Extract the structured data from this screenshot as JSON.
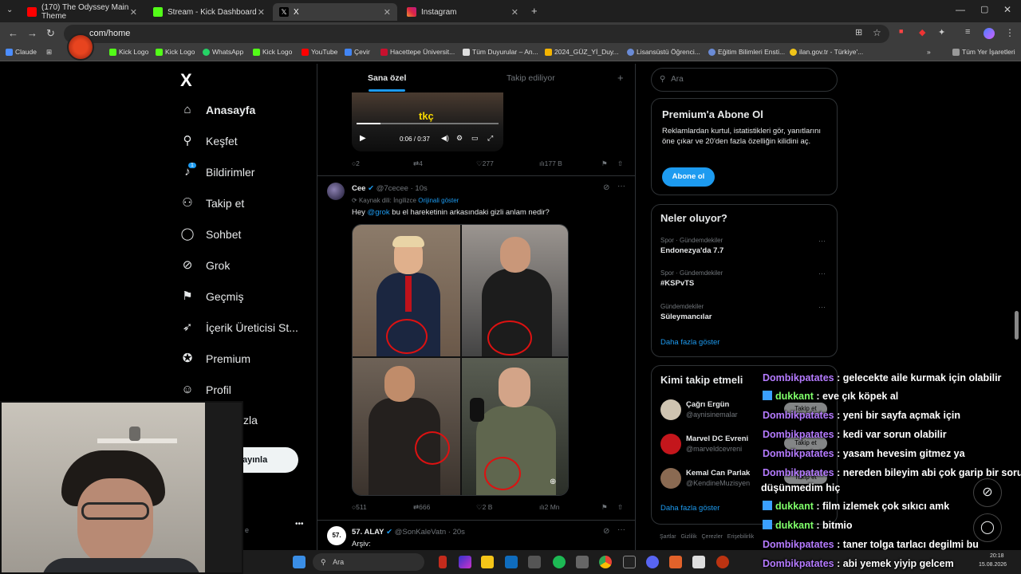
{
  "browser": {
    "tabs": [
      {
        "title": "(170) The Odyssey Main Theme",
        "color": "#ff0000"
      },
      {
        "title": "Stream - Kick Dashboard",
        "color": "#53fc18"
      },
      {
        "title": "X",
        "color": "#ffffff"
      },
      {
        "title": "Instagram",
        "color": "#e1306c"
      }
    ],
    "url": "com/home",
    "bookmarks": [
      "Claude",
      "il",
      "Kick Logo",
      "Kick Logo",
      "WhatsApp",
      "Kick Logo",
      "YouTube",
      "Çevir",
      "Hacettepe Üniversit...",
      "Tüm Duyurular – An...",
      "2024_GÜZ_Yİ_Duy...",
      "Lisansüstü Öğrenci...",
      "Eğitim Bilimleri Ensti...",
      "ilan.gov.tr - Türkiye'..."
    ],
    "all_bookmarks": "Tüm Yer İşaretleri"
  },
  "nav": {
    "logo": "X",
    "items": [
      "Anasayfa",
      "Keşfet",
      "Bildirimler",
      "Takip et",
      "Sohbet",
      "Grok",
      "Geçmiş",
      "İçerik Üreticisi St...",
      "Premium",
      "Profil",
      "zla"
    ],
    "notification_badge": "1",
    "post_button": "ayınla",
    "more": "•••",
    "bottom_text": "e"
  },
  "feed": {
    "tabs": [
      "Sana özel",
      "Takip ediliyor"
    ],
    "plus": "+",
    "video": {
      "overlay_text": "tkç",
      "time": "0:06 / 0:37"
    },
    "post1_actions": {
      "replies": "2",
      "reposts": "4",
      "likes": "277",
      "views": "177 B"
    },
    "post2": {
      "name": "Cee",
      "handle": "@7cecee · 10s",
      "source_label": "Kaynak dili: İngilizce",
      "show_original": "Orijinali göster",
      "text_prefix": "Hey ",
      "mention": "@grok",
      "text_suffix": " bu el hareketinin arkasındaki gizli anlam nedir?",
      "actions": {
        "replies": "511",
        "reposts": "666",
        "likes": "2 B",
        "views": "2 Mn"
      }
    },
    "post3": {
      "avatar_text": "57.",
      "name": "57. ALAY",
      "handle": "@SonKaleVatn · 20s",
      "text": "Arşiv:"
    }
  },
  "right": {
    "search_placeholder": "Ara",
    "premium": {
      "title": "Premium'a Abone Ol",
      "body": "Reklamlardan kurtul, istatistikleri gör, yanıtlarını öne çıkar ve 20'den fazla özelliğin kilidini aç.",
      "button": "Abone ol"
    },
    "trends": {
      "title": "Neler oluyor?",
      "items": [
        {
          "meta": "Spor · Gündemdekiler",
          "title": "Endonezya'da 7.7"
        },
        {
          "meta": "Spor · Gündemdekiler",
          "title": "#KSPvTS"
        },
        {
          "meta": "Gündemdekiler",
          "title": "Süleymancılar"
        }
      ],
      "more": "Daha fazla göster"
    },
    "who_to_follow": {
      "title": "Kimi takip etmeli",
      "users": [
        {
          "name": "Çağrı Ergün",
          "handle": "@aynisinemalar"
        },
        {
          "name": "Marvel DC Evreni",
          "handle": "@marveldcevreni"
        },
        {
          "name": "Kemal Can Parlak",
          "handle": "@KendineMuzisyen"
        }
      ],
      "follow_label": "Takip et",
      "more": "Daha fazla göster"
    },
    "footer": "Şartlar   Gizlilik   Çerezler   Erişebilirlik"
  },
  "chat": [
    {
      "user": "Dombikpatates",
      "msg": " : gelecekte aile kurmak için olabilir",
      "badge": false
    },
    {
      "user": "dukkant",
      "msg": " : eve çık köpek al",
      "badge": true
    },
    {
      "user": "Dombikpatates",
      "msg": " : yeni bir sayfa açmak için",
      "badge": false
    },
    {
      "user": "Dombikpatates",
      "msg": " : kedi var sorun olabilir",
      "badge": false
    },
    {
      "user": "Dombikpatates",
      "msg": " : yasam hevesim gitmez ya",
      "badge": false
    },
    {
      "user": "Dombikpatates",
      "msg": " : nereden bileyim abi çok garip bir soru",
      "badge": false
    },
    {
      "user": "",
      "msg": "düşünmedim hiç",
      "badge": false
    },
    {
      "user": "dukkant",
      "msg": " : film izlemek çok sıkıcı amk",
      "badge": true
    },
    {
      "user": "dukkant",
      "msg": " : bitmio",
      "badge": true
    },
    {
      "user": "Dombikpatates",
      "msg": " : taner tolga tarlacı degilmi bu",
      "badge": false
    },
    {
      "user": "Dombikpatates",
      "msg": " : abi yemek yiyip gelcem",
      "badge": false
    }
  ],
  "taskbar": {
    "search": "Ara",
    "time": "20:18",
    "date": "15.08.2026"
  },
  "colors": {
    "accent": "#1d9bf0",
    "chat_user_purple": "#b57bff",
    "chat_user_green": "#7fff6a"
  }
}
